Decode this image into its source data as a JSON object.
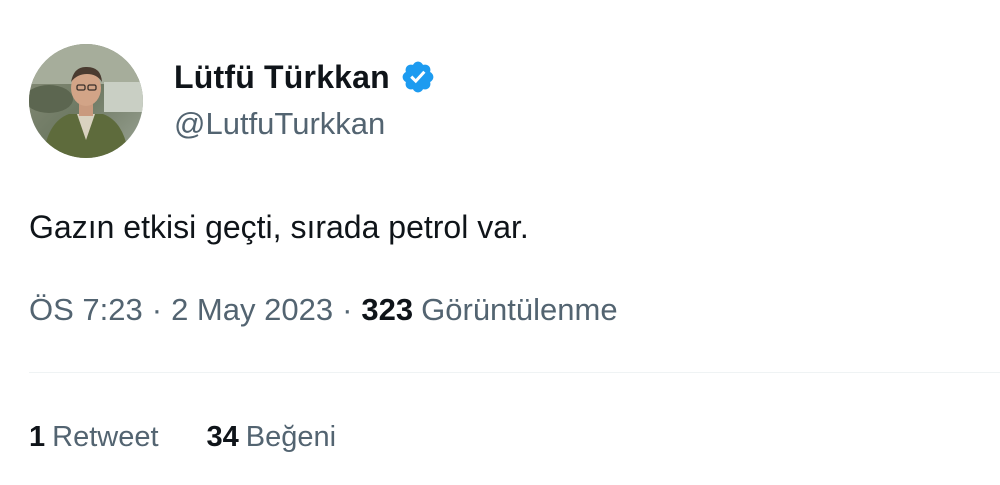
{
  "author": {
    "display_name": "Lütfü Türkkan",
    "handle": "@LutfuTurkkan",
    "verified": true,
    "avatar_icon": "profile-photo",
    "badge_icon": "verified-check-icon"
  },
  "tweet": {
    "text": "Gazın etkisi geçti, sırada petrol var.",
    "time": "ÖS 7:23",
    "date": "2 May 2023",
    "separator": "·",
    "views_count": "323",
    "views_label": "Görüntülenme"
  },
  "stats": {
    "retweets_count": "1",
    "retweets_label": "Retweet",
    "likes_count": "34",
    "likes_label": "Beğeni"
  },
  "colors": {
    "primary_text": "#0f1419",
    "secondary_text": "#536471",
    "verified_blue": "#1d9bf0",
    "divider": "#eff3f4"
  }
}
